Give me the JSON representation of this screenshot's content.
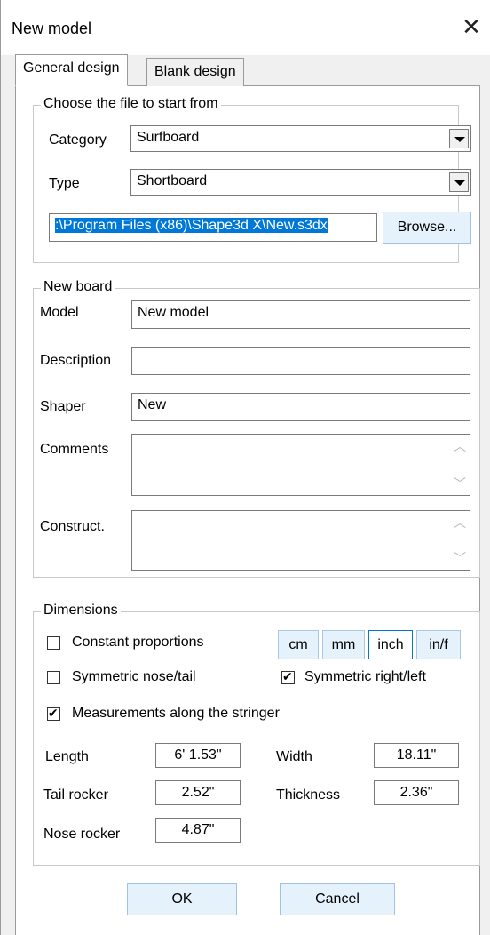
{
  "window": {
    "title": "New model"
  },
  "tabs": [
    {
      "label": "General design",
      "active": true
    },
    {
      "label": "Blank design",
      "active": false
    }
  ],
  "file_group": {
    "label": "Choose the file to start from",
    "category_label": "Category",
    "category_value": "Surfboard",
    "type_label": "Type",
    "type_value": "Shortboard",
    "path_value": ":\\Program Files (x86)\\Shape3d X\\New.s3dx",
    "browse_label": "Browse..."
  },
  "board_group": {
    "label": "New board",
    "model_label": "Model",
    "model_value": "New model",
    "description_label": "Description",
    "description_value": "",
    "shaper_label": "Shaper",
    "shaper_value": "New",
    "comments_label": "Comments",
    "construct_label": "Construct."
  },
  "dimensions": {
    "label": "Dimensions",
    "units": [
      "cm",
      "mm",
      "inch",
      "in/f"
    ],
    "active_unit": "inch",
    "constant_proportions": {
      "label": "Constant proportions",
      "checked": false
    },
    "symmetric_nose_tail": {
      "label": "Symmetric nose/tail",
      "checked": false
    },
    "symmetric_right_left": {
      "label": "Symmetric right/left",
      "checked": true
    },
    "along_stringer": {
      "label": "Measurements along the stringer",
      "checked": true
    },
    "length_label": "Length",
    "length_value": "6' 1.53\"",
    "width_label": "Width",
    "width_value": "18.11\"",
    "tail_rocker_label": "Tail rocker",
    "tail_rocker_value": "2.52\"",
    "thickness_label": "Thickness",
    "thickness_value": "2.36\"",
    "nose_rocker_label": "Nose rocker",
    "nose_rocker_value": "4.87\""
  },
  "buttons": {
    "ok": "OK",
    "cancel": "Cancel"
  }
}
